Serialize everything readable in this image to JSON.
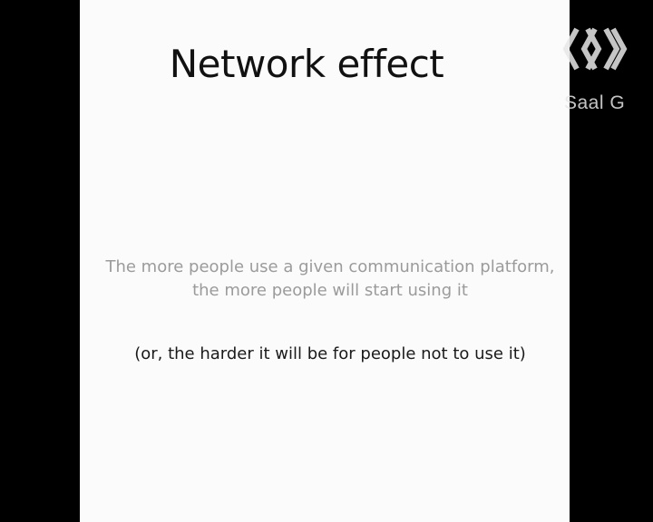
{
  "slide": {
    "title": "Network effect",
    "body": "The more people use a given communication platform, the more people will start using it",
    "note": "(or, the harder it will be for people not to use it)"
  },
  "overlay": {
    "room_label": "Saal G",
    "logo_icon": "ccc-logo-icon"
  },
  "colors": {
    "background": "#000000",
    "slide_background": "#fbfbfb",
    "title": "#111111",
    "body": "#9b9b9b",
    "note": "#1a1a1a",
    "overlay": "#e6e6e6"
  }
}
